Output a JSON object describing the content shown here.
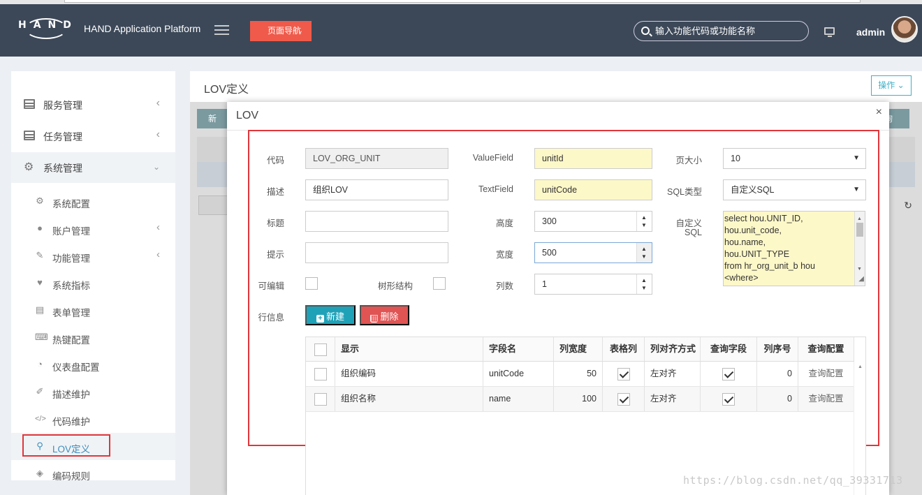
{
  "header": {
    "logo_text": "HAND",
    "app_title": "HAND Application Platform",
    "page_nav_label": "页面导航",
    "search_placeholder": "输入功能代码或功能名称",
    "user": "admin"
  },
  "sidebar": {
    "groups": [
      {
        "label": "服务管理"
      },
      {
        "label": "任务管理"
      },
      {
        "label": "系统管理"
      }
    ],
    "sub_items": [
      {
        "label": "系统配置"
      },
      {
        "label": "账户管理"
      },
      {
        "label": "功能管理"
      },
      {
        "label": "系统指标"
      },
      {
        "label": "表单管理"
      },
      {
        "label": "热键配置"
      },
      {
        "label": "仪表盘配置"
      },
      {
        "label": "描述维护"
      },
      {
        "label": "代码维护"
      },
      {
        "label": "LOV定义"
      },
      {
        "label": "编码规则"
      }
    ]
  },
  "content": {
    "title": "LOV定义",
    "ops_label": "操作",
    "bg_new": "新",
    "bg_query": "询"
  },
  "modal": {
    "title": "LOV",
    "close": "×",
    "form": {
      "code_label": "代码",
      "code_value": "LOV_ORG_UNIT",
      "desc_label": "描述",
      "desc_value": "组织LOV",
      "title_label": "标题",
      "title_value": "",
      "hint_label": "提示",
      "hint_value": "",
      "editable_label": "可编辑",
      "tree_label": "树形结构",
      "valuefield_label": "ValueField",
      "valuefield_value": "unitId",
      "textfield_label": "TextField",
      "textfield_value": "unitCode",
      "height_label": "高度",
      "height_value": "300",
      "width_label": "宽度",
      "width_value": "500",
      "columns_label": "列数",
      "columns_value": "1",
      "pagesize_label": "页大小",
      "pagesize_value": "10",
      "sqltype_label": "SQL类型",
      "sqltype_value": "自定义SQL",
      "customsql_label_1": "自定义",
      "customsql_label_2": "SQL",
      "customsql_lines": [
        "select hou.UNIT_ID,",
        "hou.unit_code,",
        "hou.name,",
        "hou.UNIT_TYPE",
        "from hr_org_unit_b hou",
        "<where>"
      ]
    },
    "rowinfo_label": "行信息",
    "new_button": "新建",
    "delete_button": "删除",
    "grid": {
      "headers": [
        "显示",
        "字段名",
        "列宽度",
        "表格列",
        "列对齐方式",
        "查询字段",
        "列序号",
        "查询配置"
      ],
      "rows": [
        {
          "display": "组织编码",
          "field": "unitCode",
          "width": "50",
          "grid_col": true,
          "align": "左对齐",
          "query_field": true,
          "order": "0",
          "query_cfg": "查询配置"
        },
        {
          "display": "组织名称",
          "field": "name",
          "width": "100",
          "grid_col": true,
          "align": "左对齐",
          "query_field": true,
          "order": "0",
          "query_cfg": "查询配置"
        }
      ]
    }
  },
  "watermark": "https://blog.csdn.net/qq_39331713",
  "colors": {
    "header_bg": "#3c4858",
    "accent_red": "#f05a4a",
    "primary": "#1fa2b8",
    "danger": "#e05454",
    "highlight_box": "#e0363b"
  }
}
